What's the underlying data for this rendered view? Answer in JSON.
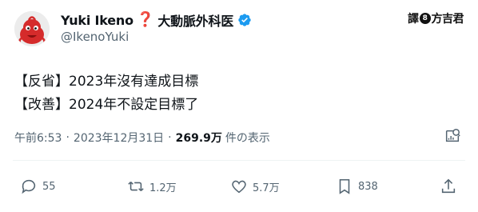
{
  "author": {
    "display_name": "Yuki Ikeno",
    "emoji": "❓",
    "title_suffix": "大動脈外科医",
    "handle": "@IkenoYuki",
    "verified": true
  },
  "watermark": {
    "text_left": "譯",
    "badge": "8",
    "text_right": "方吉君"
  },
  "tweet": {
    "lines": [
      "【反省】2023年沒有達成目標",
      "【改善】2024年不設定目標了"
    ]
  },
  "meta": {
    "time": "午前6:53",
    "date": "2023年12月31日",
    "views_count": "269.9万",
    "views_label": "件の表示"
  },
  "actions": {
    "reply_count": "55",
    "retweet_count": "1.2万",
    "like_count": "5.7万",
    "bookmark_count": "838"
  },
  "colors": {
    "text": "#0f1419",
    "muted": "#536471",
    "verified_blue": "#1d9bf0",
    "question_mark_red": "#c21d2e",
    "avatar_red": "#d52b2b"
  },
  "icons": [
    "avatar-character-icon",
    "verified-badge-icon",
    "analytics-icon",
    "reply-icon",
    "retweet-icon",
    "like-icon",
    "bookmark-icon",
    "share-icon"
  ]
}
